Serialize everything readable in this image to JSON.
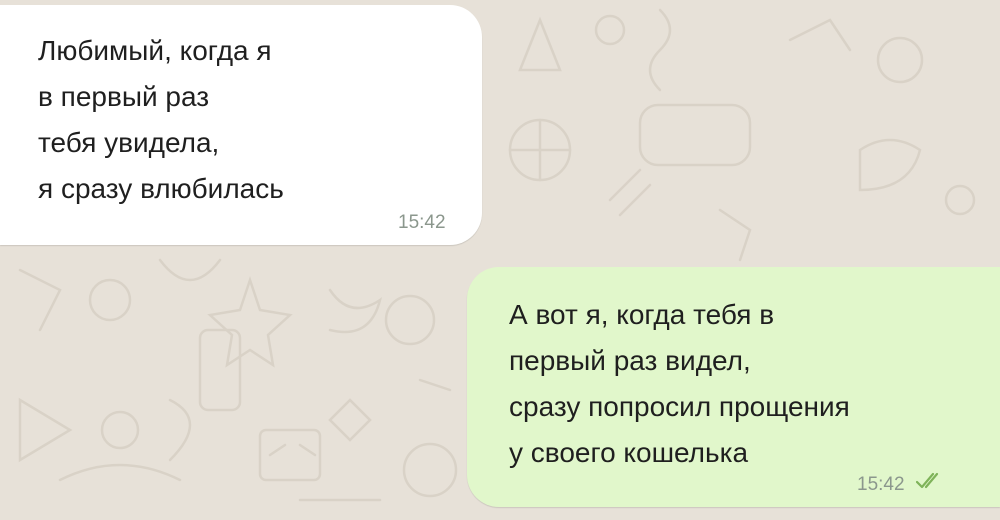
{
  "chat": {
    "messages": [
      {
        "direction": "incoming",
        "lines": [
          "Любимый, когда я",
          "в первый раз",
          "тебя увидела,",
          "я сразу влюбилась"
        ],
        "time": "15:42"
      },
      {
        "direction": "outgoing",
        "lines": [
          "А вот я, когда тебя в",
          "первый раз видел,",
          "сразу попросил прощения",
          "у своего кошелька"
        ],
        "time": "15:42",
        "status_icon": "double-check-icon"
      }
    ]
  },
  "colors": {
    "wallpaper": "#e7e1d8",
    "incoming_bubble": "#ffffff",
    "outgoing_bubble": "#e1f7cb",
    "timestamp": "#8b978d",
    "read_ticks": "#7fb35a"
  }
}
